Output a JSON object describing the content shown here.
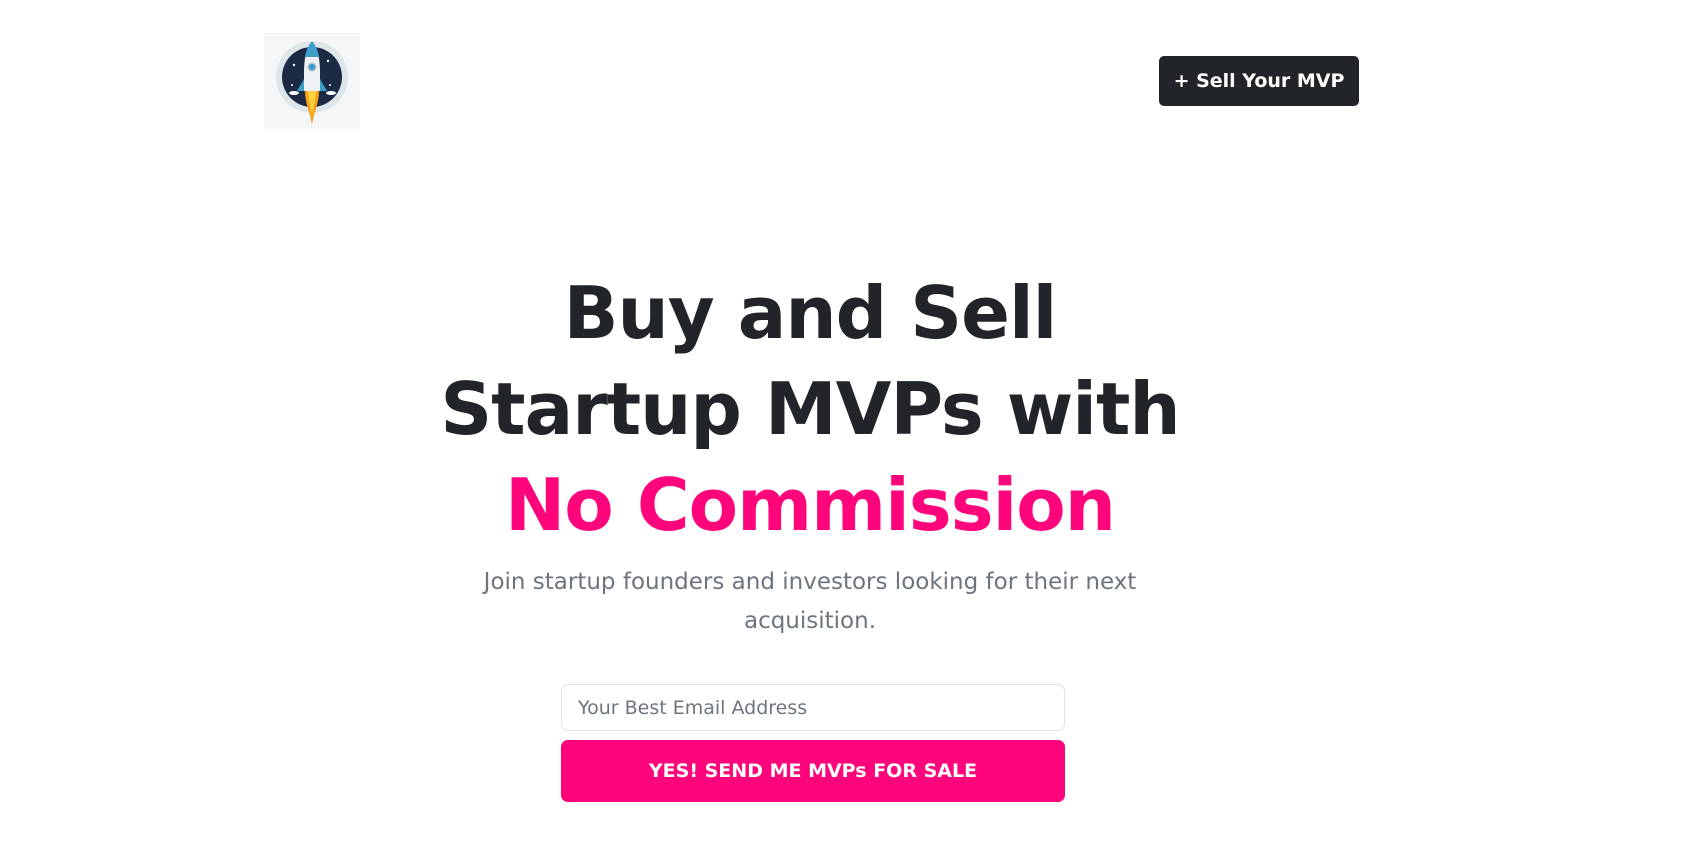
{
  "header": {
    "logo_icon": "rocket-logo-icon",
    "sell_button_label": "+ Sell Your MVP"
  },
  "hero": {
    "title_line1": "Buy and Sell",
    "title_line2": "Startup MVPs with",
    "title_accent": "No Commission",
    "subtitle": "Join startup founders and investors looking for their next acquisition."
  },
  "signup": {
    "email_placeholder": "Your Best Email Address",
    "email_value": "",
    "submit_label": "YES! SEND ME MVPs FOR SALE"
  },
  "colors": {
    "accent": "#ff057c",
    "dark": "#212529",
    "muted": "#6c757d"
  }
}
